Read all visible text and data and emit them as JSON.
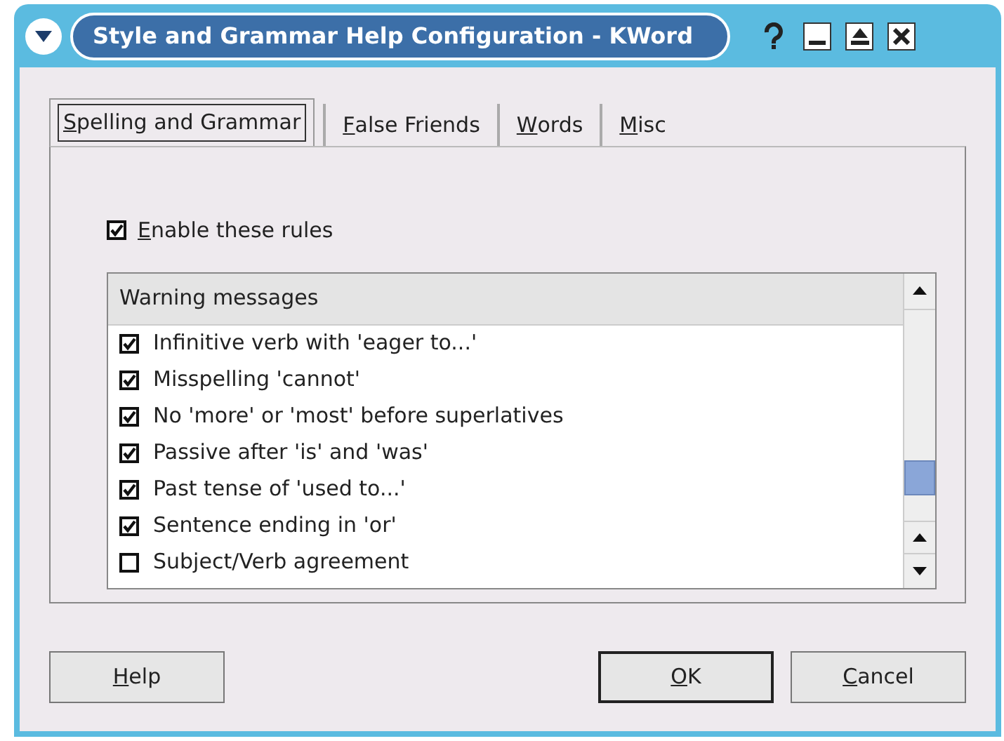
{
  "window": {
    "title": "Style and Grammar Help Configuration - KWord"
  },
  "tabs": [
    {
      "accel": "S",
      "rest": "pelling and Grammar",
      "selected": true
    },
    {
      "accel": "F",
      "rest": "alse Friends",
      "selected": false
    },
    {
      "accel": "W",
      "rest": "ords",
      "selected": false
    },
    {
      "accel": "M",
      "rest": "isc",
      "selected": false
    }
  ],
  "enable": {
    "accel": "E",
    "rest": "nable these rules",
    "checked": true
  },
  "list": {
    "header": "Warning messages",
    "rows": [
      {
        "label": "Infinitive verb with 'eager to...'",
        "checked": true
      },
      {
        "label": "Misspelling 'cannot'",
        "checked": true
      },
      {
        "label": "No 'more' or 'most' before superlatives",
        "checked": true
      },
      {
        "label": "Passive after 'is' and 'was'",
        "checked": true
      },
      {
        "label": "Past tense of 'used to...'",
        "checked": true
      },
      {
        "label": "Sentence ending in 'or'",
        "checked": true
      },
      {
        "label": "Subject/Verb agreement",
        "checked": false
      }
    ]
  },
  "buttons": [
    {
      "accel": "H",
      "rest": "elp",
      "default": false
    },
    {
      "accel": "O",
      "rest": "K",
      "default": true
    },
    {
      "accel": "C",
      "rest": "ancel",
      "default": false
    }
  ]
}
